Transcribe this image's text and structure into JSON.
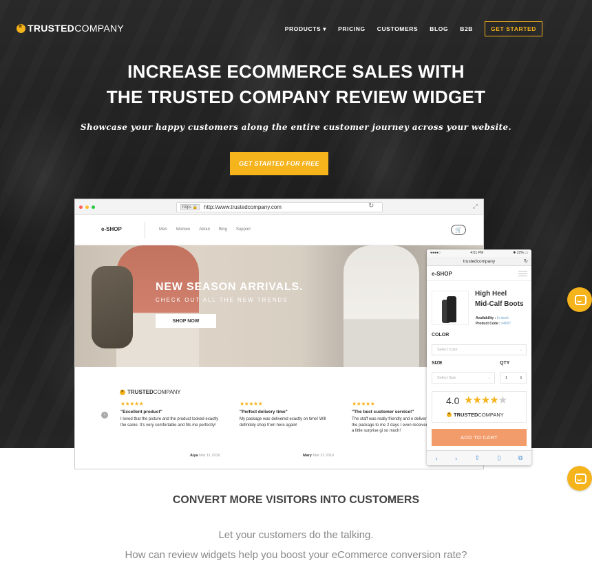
{
  "brand": {
    "name_bold": "TRUSTED",
    "name_rest": "COMPANY"
  },
  "nav": {
    "items": [
      "PRODUCTS ▾",
      "PRICING",
      "CUSTOMERS",
      "BLOG",
      "B2B"
    ],
    "cta": "GET STARTED"
  },
  "hero": {
    "title_line1": "INCREASE ECOMMERCE SALES WITH",
    "title_line2": "THE TRUSTED COMPANY REVIEW WIDGET",
    "subtitle": "Showcase your happy customers along the entire customer journey across your website.",
    "button": "GET STARTED FOR FREE"
  },
  "browser": {
    "https": "https 🔒",
    "url": "http://www.trustedcompany.com"
  },
  "shop": {
    "logo": "e-SHOP",
    "links": [
      "Men",
      "Women",
      "About",
      "Blog",
      "Support"
    ],
    "banner_title": "NEW SEASON ARRIVALS.",
    "banner_sub": "CHECK OUT ALL THE NEW TRENDS",
    "banner_button": "SHOP NOW"
  },
  "reviews": [
    {
      "stars": "★★★★★",
      "title": "\"Excellent product\"",
      "text": "I loved that the picture and the product looked exactly the same. It's very comfortable and fits me perfectly!",
      "author": "Aiya",
      "date": "Mar 11 2016"
    },
    {
      "stars": "★★★★★",
      "title": "\"Perfect delivery time\"",
      "text": "My package was delivered exactly on time! Will definitely shop from here again!",
      "author": "Mary",
      "date": "Mar 22 2016"
    },
    {
      "stars": "★★★★★",
      "title": "\"The best customer service!\"",
      "text": "The staff was really friendly and e deliver the package to me 2 days I even received a little surprise gi so much!",
      "author": "",
      "date": ""
    }
  ],
  "phone": {
    "status_left": "●●●●○",
    "time": "4:01 PM",
    "battery": "✱ 22% ▭",
    "url": "trustedcompany",
    "shop": "e-SHOP",
    "product_line1": "High Heel",
    "product_line2": "Mid-Calf Boots",
    "availability_label": "Availability :",
    "availability_value": "In stock",
    "code_label": "Product Code :",
    "code_value": "#4657",
    "color_label": "COLOR",
    "color_placeholder": "Select Color",
    "size_label": "SIZE",
    "qty_label": "QTY",
    "size_placeholder": "Select Size",
    "qty_value": "1",
    "rating": "4.0",
    "add_to_cart": "ADD TO CART"
  },
  "section": {
    "title": "CONVERT MORE VISITORS INTO CUSTOMERS",
    "line1": "Let your customers do the talking.",
    "line2": "How can review widgets help you boost your eCommerce conversion rate?"
  },
  "colors": {
    "accent": "#f5b31c",
    "cart_button": "#f39c6b"
  }
}
